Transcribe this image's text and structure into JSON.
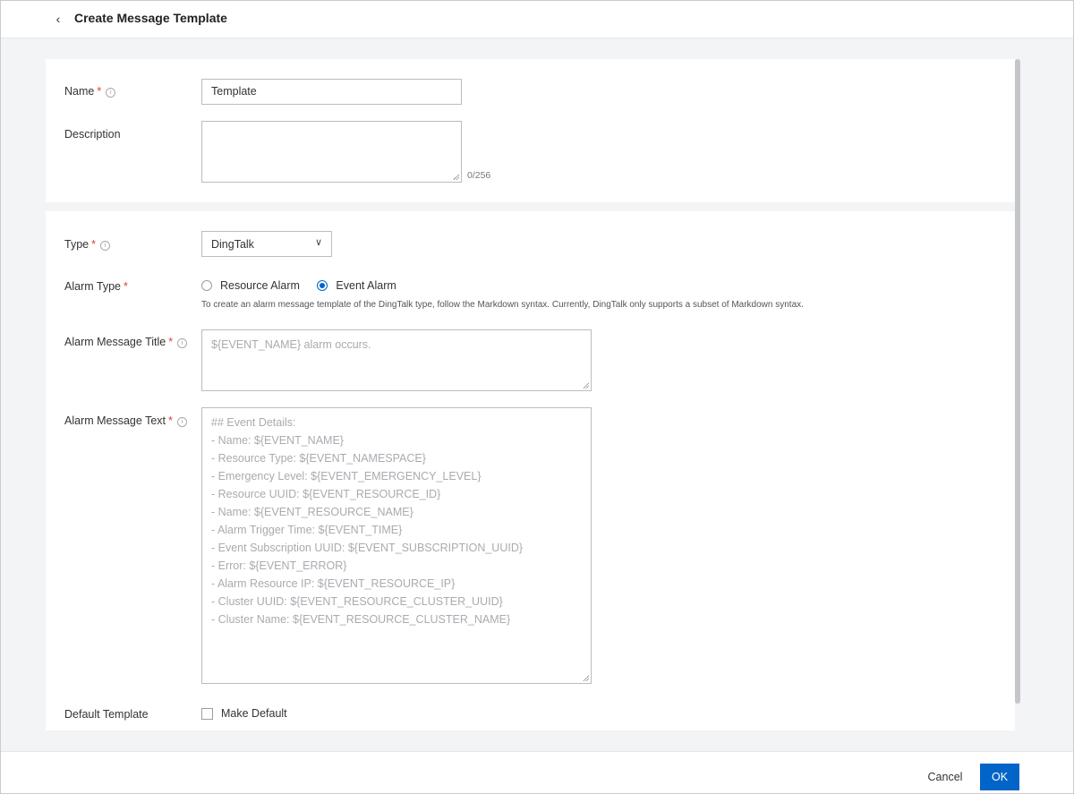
{
  "header": {
    "back_glyph": "‹",
    "title": "Create Message Template"
  },
  "form": {
    "name": {
      "label": "Name",
      "value": "Template"
    },
    "description": {
      "label": "Description",
      "value": "",
      "counter": "0/256"
    },
    "type": {
      "label": "Type",
      "selected": "DingTalk"
    },
    "alarm_type": {
      "label": "Alarm Type",
      "options": [
        {
          "label": "Resource Alarm",
          "checked": false
        },
        {
          "label": "Event Alarm",
          "checked": true
        }
      ],
      "hint": "To create an alarm message template of the DingTalk type, follow the Markdown syntax. Currently, DingTalk only supports a subset of Markdown syntax."
    },
    "alarm_title": {
      "label": "Alarm Message Title",
      "placeholder": "${EVENT_NAME} alarm occurs."
    },
    "alarm_text": {
      "label": "Alarm Message Text",
      "placeholder_lines": [
        "## Event Details:",
        "- Name: ${EVENT_NAME}",
        "- Resource Type: ${EVENT_NAMESPACE}",
        "- Emergency Level: ${EVENT_EMERGENCY_LEVEL}",
        "- Resource UUID: ${EVENT_RESOURCE_ID}",
        "- Name: ${EVENT_RESOURCE_NAME}",
        "- Alarm Trigger Time: ${EVENT_TIME}",
        "- Event Subscription UUID: ${EVENT_SUBSCRIPTION_UUID}",
        "- Error: ${EVENT_ERROR}",
        "- Alarm Resource IP: ${EVENT_RESOURCE_IP}",
        "- Cluster UUID: ${EVENT_RESOURCE_CLUSTER_UUID}",
        "- Cluster Name: ${EVENT_RESOURCE_CLUSTER_NAME}"
      ]
    },
    "default_template": {
      "label": "Default Template",
      "checkbox_label": "Make Default",
      "checked": false
    }
  },
  "footer": {
    "cancel_label": "Cancel",
    "ok_label": "OK"
  },
  "icons": {
    "info": "i",
    "chevron": "∨"
  },
  "colors": {
    "primary": "#0064c8",
    "required": "#e4393c"
  },
  "required_mark": "*"
}
